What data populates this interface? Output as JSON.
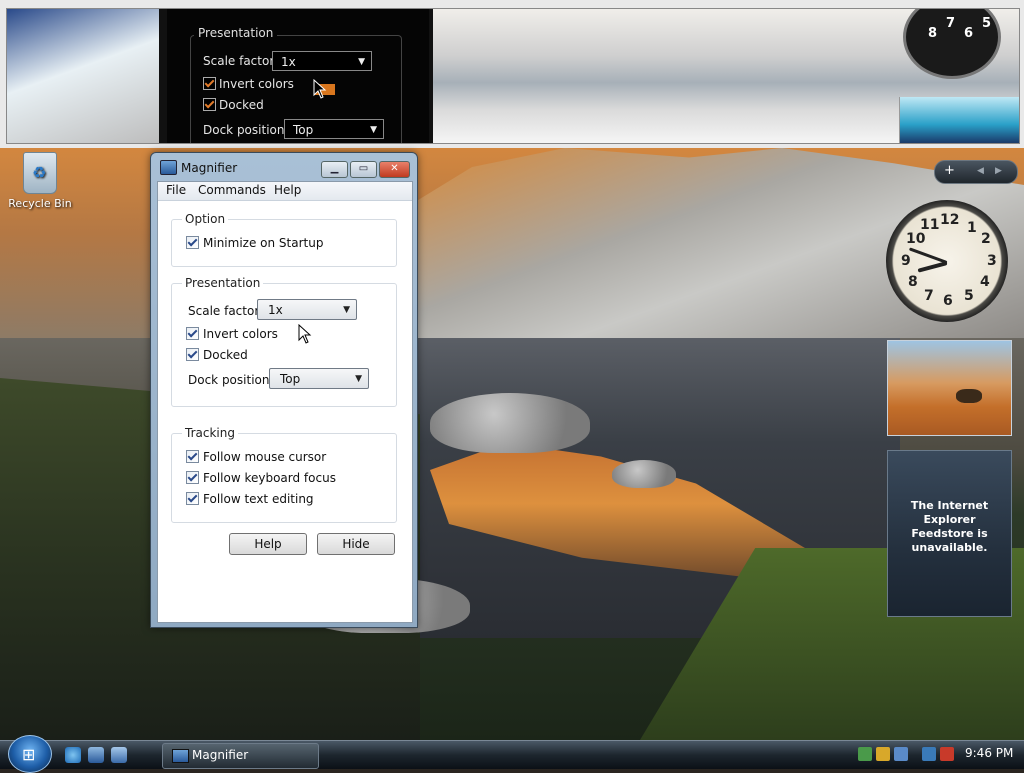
{
  "magnifier_view": {
    "group_title": "Presentation",
    "scale_label": "Scale factor:",
    "scale_value": "1x",
    "invert_label": "Invert colors",
    "docked_label": "Docked",
    "dock_label": "Dock position:",
    "dock_value": "Top"
  },
  "window": {
    "title": "Magnifier",
    "menu": [
      "File",
      "Commands",
      "Help"
    ],
    "option": {
      "title": "Option",
      "minimize_label": "Minimize on Startup",
      "minimize_checked": true
    },
    "presentation": {
      "title": "Presentation",
      "scale_label": "Scale factor:",
      "scale_value": "1x",
      "invert_label": "Invert colors",
      "invert_checked": true,
      "docked_label": "Docked",
      "docked_checked": true,
      "dock_label": "Dock position:",
      "dock_value": "Top"
    },
    "tracking": {
      "title": "Tracking",
      "mouse_label": "Follow mouse cursor",
      "keyboard_label": "Follow keyboard focus",
      "text_label": "Follow text editing"
    },
    "buttons": {
      "help": "Help",
      "hide": "Hide"
    }
  },
  "desktop": {
    "recycle_bin": "Recycle Bin"
  },
  "sidebar": {
    "feed_message": "The Internet Explorer Feedstore is unavailable."
  },
  "taskbar": {
    "task_label": "Magnifier",
    "time": "9:46 PM"
  },
  "colors": {
    "accent_orange": "#d8761e",
    "taskbar": "#1d262e",
    "window_frame": "#a9c0d6"
  }
}
